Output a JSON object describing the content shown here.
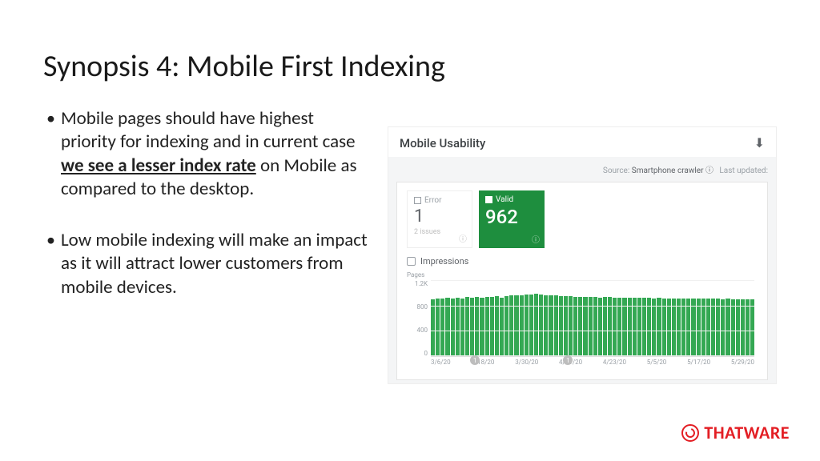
{
  "title": "Synopsis 4: Mobile First Indexing",
  "bullets": {
    "b1_part1": "Mobile pages should have highest priority for indexing and in current case ",
    "b1_bold": "we see a lesser index rate",
    "b1_part2": " on Mobile as compared to the desktop.",
    "b2": "Low mobile indexing will make an impact as it will attract lower customers from mobile devices."
  },
  "panel": {
    "title": "Mobile Usability",
    "source_label": "Source:",
    "source_value": "Smartphone crawler",
    "last_updated": "Last updated:",
    "error": {
      "label": "Error",
      "value": "1",
      "sub": "2 issues"
    },
    "valid": {
      "label": "Valid",
      "value": "962"
    },
    "impressions": "Impressions"
  },
  "brand": "THATWARE",
  "chart_data": {
    "type": "bar",
    "title": "Pages",
    "ylabel": "Pages",
    "ylim": [
      0,
      1200
    ],
    "yticks": [
      "1.2K",
      "800",
      "400",
      "0"
    ],
    "categories": [
      "3/6/20",
      "3/18/20",
      "3/30/20",
      "4/11/20",
      "4/23/20",
      "5/5/20",
      "5/17/20",
      "5/29/20"
    ],
    "values": [
      900,
      910,
      905,
      920,
      915,
      925,
      910,
      930,
      920,
      935,
      925,
      940,
      935,
      945,
      920,
      950,
      955,
      960,
      965,
      970,
      975,
      980,
      970,
      965,
      960,
      955,
      950,
      948,
      945,
      940,
      938,
      935,
      932,
      930,
      928,
      930,
      932,
      925,
      928,
      922,
      925,
      920,
      922,
      918,
      920,
      915,
      918,
      912,
      915,
      910,
      912,
      908,
      910,
      906,
      908,
      905,
      906,
      904,
      905,
      903,
      904,
      902,
      903,
      901,
      902,
      900
    ],
    "markers": [
      {
        "x_index": 9,
        "label": "1"
      },
      {
        "x_index": 28,
        "label": "1"
      }
    ]
  }
}
